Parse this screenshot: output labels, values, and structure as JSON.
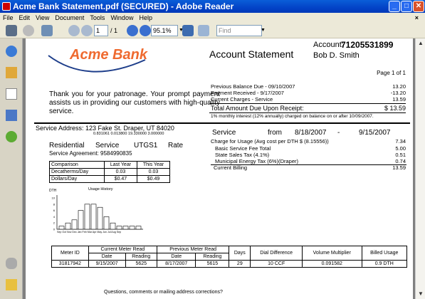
{
  "window": {
    "title": "Acme Bank Statement.pdf (SECURED) - Adobe Reader"
  },
  "menu": [
    "File",
    "Edit",
    "View",
    "Document",
    "Tools",
    "Window",
    "Help"
  ],
  "toolbar": {
    "page_current": "1",
    "page_total": "/ 1",
    "zoom": "95.1%",
    "find_placeholder": "Find"
  },
  "doc": {
    "logo": "Acme Bank",
    "heading": "Account Statement",
    "account_label": "Account:",
    "account_number": "71205531899",
    "customer": "Bob D. Smith",
    "page_of": "Page 1 of 1",
    "thanks": "Thank you for your patronage. Your prompt payment assists us in providing our customers with high-quality service.",
    "summary": [
      {
        "label": "Previous Balance Due - 09/10/2007",
        "value": "13.20"
      },
      {
        "label": "Payment Received - 9/17/2007",
        "value": "-13.20"
      },
      {
        "label": "Current Charges - Service",
        "value": "13.59"
      }
    ],
    "total_label": "Total Amount Due Upon Receipt:",
    "total_value": "$ 13.59",
    "interest_note": "1% monthly interest (12% annually) charged on balance on or after 10/09/2007.",
    "service_address": "Service Address: 123 Fake St. Draper, UT 84020",
    "rate_numbers": "0.831061 0.013800 19.330000 3.000000",
    "rate_line": [
      "Residential",
      "Service",
      "UTGS1",
      "Rate"
    ],
    "service_agreement": "Service Agreement: 9584990835",
    "service_period": [
      "Service",
      "from",
      "8/18/2007",
      "-",
      "9/15/2007"
    ],
    "charges": [
      {
        "label": "Charge for Usage (Avg cost per DTH $ (8.15556))",
        "value": "7.34"
      },
      {
        "label": "Basic Service Fee Total",
        "value": "5.00"
      },
      {
        "label": "State Sales Tax (4.1%)",
        "value": "0.51"
      },
      {
        "label": "Municipal Energy Tax (6%)(Draper)",
        "value": "0.74"
      }
    ],
    "current_billing_label": "Current Billing",
    "current_billing_value": "13.59",
    "comparison": {
      "headers": [
        "Comparison",
        "Last Year",
        "This Year"
      ],
      "rows": [
        [
          "Decatherms/Day",
          "0.03",
          "0.03"
        ],
        [
          "Dollars/Day",
          "$0.47",
          "$0.49"
        ]
      ]
    },
    "usage_title": "Usage History",
    "usage_unit": "DTH",
    "usage_ticks": [
      "10",
      "8",
      "6",
      "4",
      "2",
      "0"
    ],
    "usage_months": "Sep Oct Nov Dec Jan Feb Mar Apr May Jun Jul Aug Sep",
    "usage_values": [
      1,
      2,
      3,
      6,
      8,
      8,
      7,
      4,
      2,
      1,
      1,
      1,
      1
    ],
    "meter": {
      "groups": {
        "current": "Current Meter Read",
        "previous": "Previous Meter Read"
      },
      "h_meter": "Meter ID",
      "h_date": "Date",
      "h_reading": "Reading",
      "h_days": "Days",
      "h_dial": "Dial Difference",
      "h_vol": "Volume Multiplier",
      "h_billed": "Billed Usage",
      "row": [
        "31817942",
        "9/15/2007",
        "5625",
        "8/17/2007",
        "5615",
        "29",
        "10    CCF",
        "0.091582",
        "0.9 DTH"
      ]
    },
    "footer": "Questions, comments or mailing address corrections?"
  }
}
